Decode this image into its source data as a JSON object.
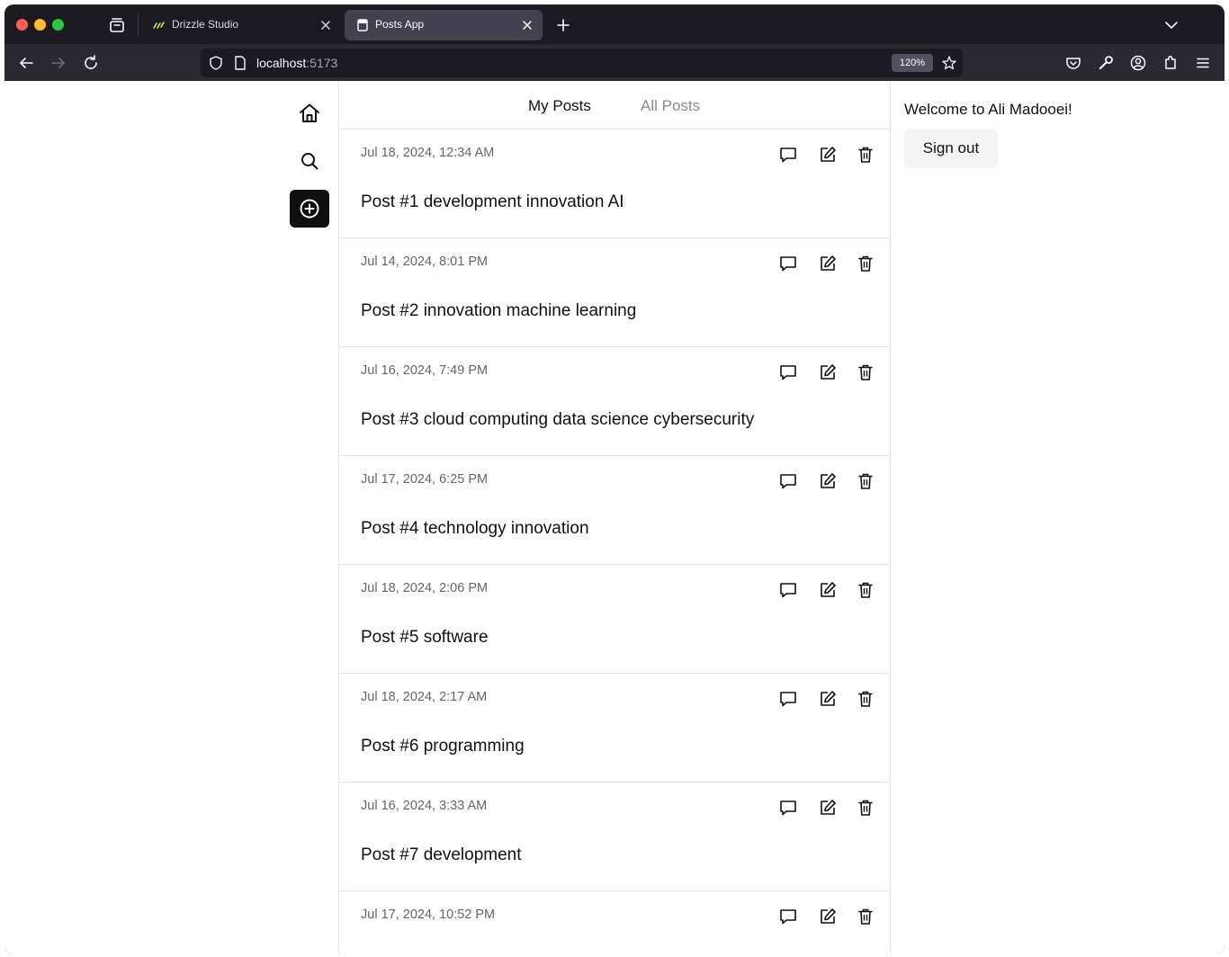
{
  "browser": {
    "tabs": [
      {
        "title": "Drizzle Studio",
        "favicon": "drizzle-logo-icon",
        "active": false
      },
      {
        "title": "Posts App",
        "favicon": "page-icon",
        "active": true
      }
    ],
    "url_host": "localhost",
    "url_port": ":5173",
    "zoom": "120%"
  },
  "feed": {
    "tabs": {
      "my_posts": "My Posts",
      "all_posts": "All Posts"
    },
    "posts": [
      {
        "date": "Jul 18, 2024, 12:34 AM",
        "title": "Post #1 development innovation AI"
      },
      {
        "date": "Jul 14, 2024, 8:01 PM",
        "title": "Post #2 innovation machine learning"
      },
      {
        "date": "Jul 16, 2024, 7:49 PM",
        "title": "Post #3 cloud computing data science cybersecurity"
      },
      {
        "date": "Jul 17, 2024, 6:25 PM",
        "title": "Post #4 technology innovation"
      },
      {
        "date": "Jul 18, 2024, 2:06 PM",
        "title": "Post #5 software"
      },
      {
        "date": "Jul 18, 2024, 2:17 AM",
        "title": "Post #6 programming"
      },
      {
        "date": "Jul 16, 2024, 3:33 AM",
        "title": "Post #7 development"
      },
      {
        "date": "Jul 17, 2024, 10:52 PM",
        "title": ""
      }
    ]
  },
  "sidebar": {
    "items": [
      {
        "icon": "home-icon"
      },
      {
        "icon": "search-icon"
      },
      {
        "icon": "plus-circle-icon"
      }
    ]
  },
  "account": {
    "welcome": "Welcome to Ali Madooei!",
    "sign_out": "Sign out"
  },
  "colors": {
    "browser_chrome": "#1c1b22",
    "toolbar": "#2b2a33",
    "active_tab": "#42414d",
    "create_button": "#0f0f0f",
    "muted_text": "#8a8a8a",
    "divider": "#e5e5e5"
  }
}
